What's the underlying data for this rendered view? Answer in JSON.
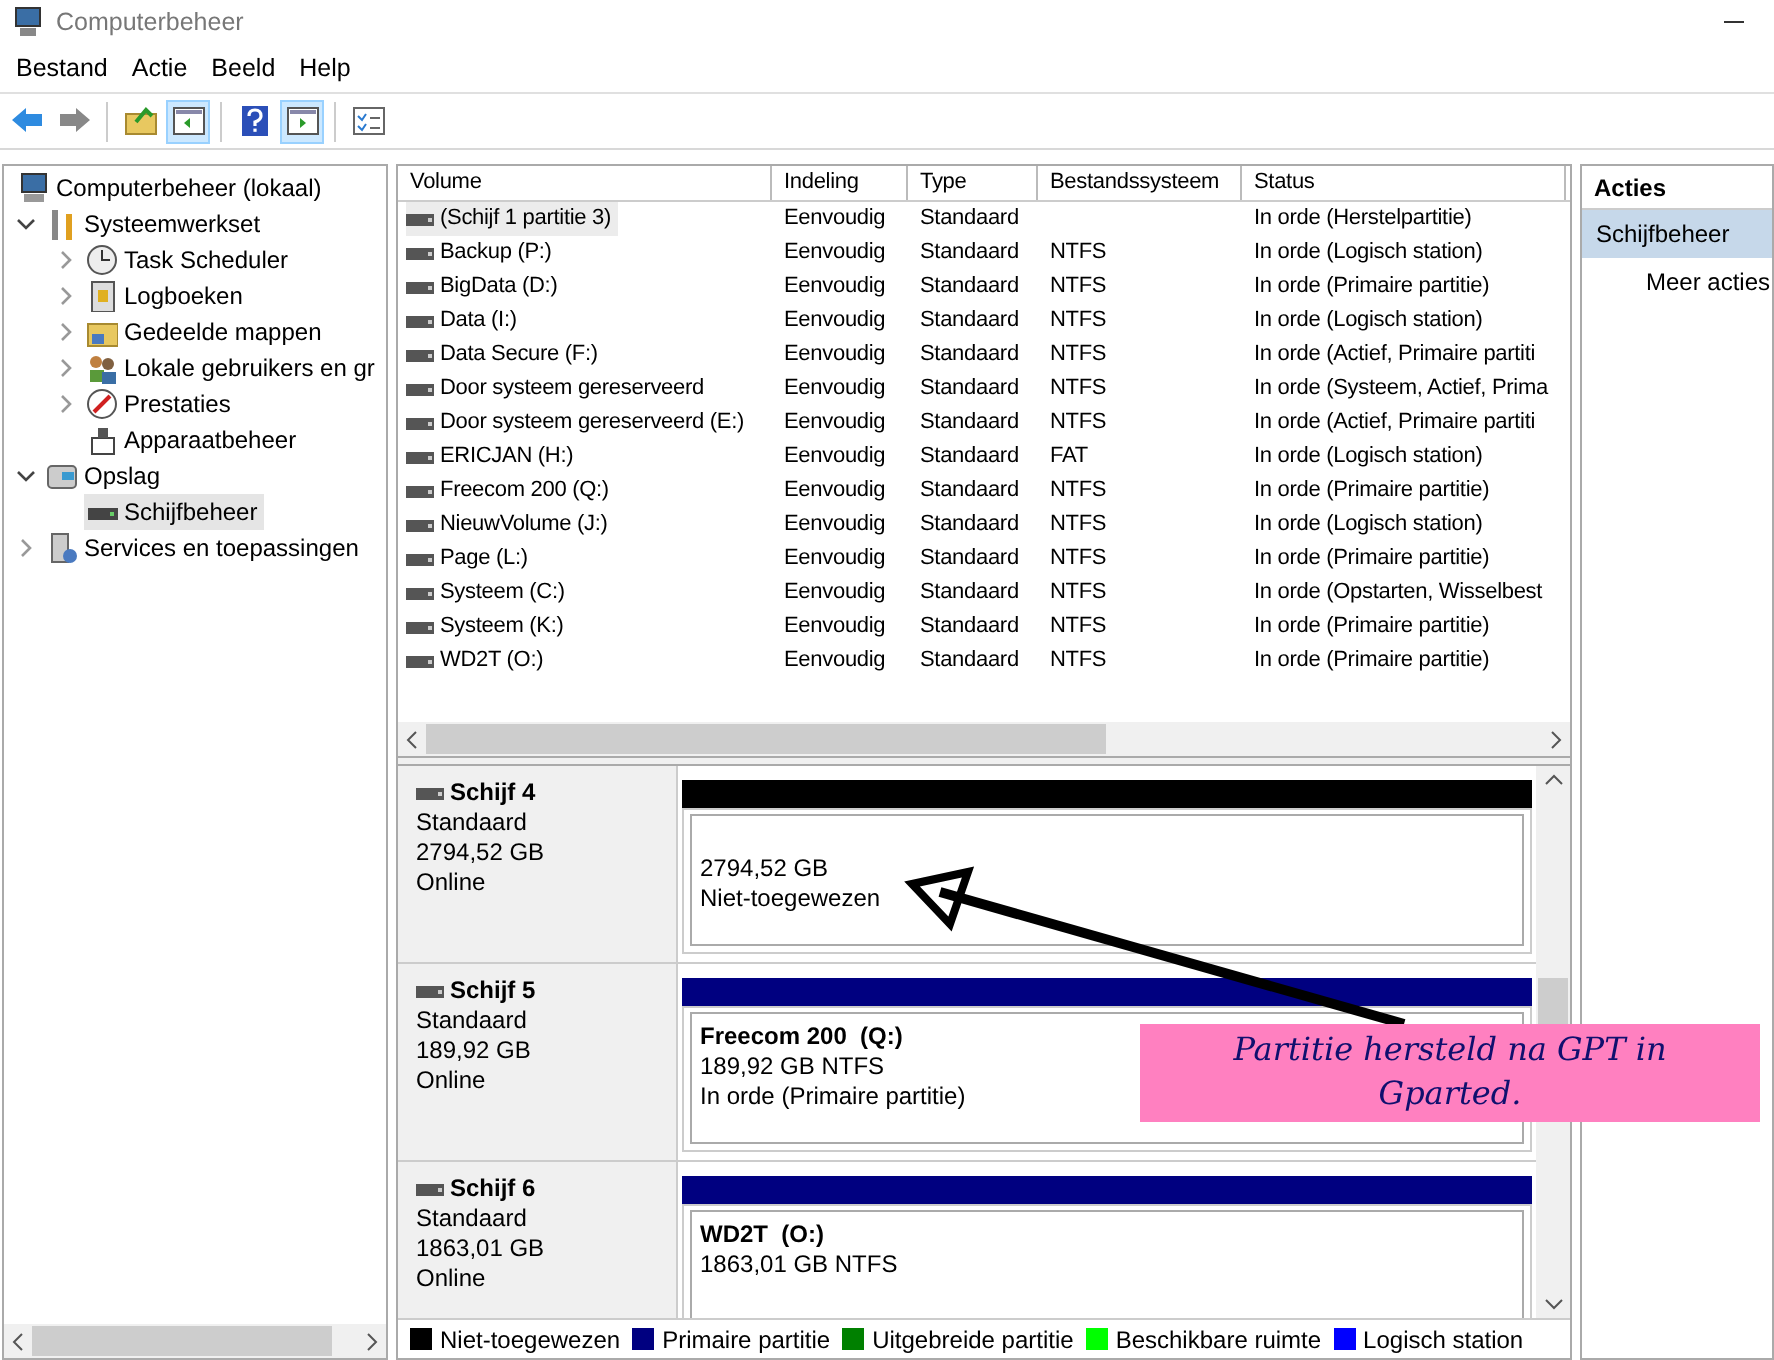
{
  "window": {
    "title": "Computerbeheer"
  },
  "menu": [
    "Bestand",
    "Actie",
    "Beeld",
    "Help"
  ],
  "toolbar": [
    {
      "kind": "back",
      "pressed": false
    },
    {
      "kind": "forward",
      "pressed": false
    },
    {
      "kind": "sep"
    },
    {
      "kind": "up",
      "pressed": false
    },
    {
      "kind": "tree",
      "pressed": true
    },
    {
      "kind": "sep"
    },
    {
      "kind": "help",
      "pressed": false
    },
    {
      "kind": "actionpane",
      "pressed": true
    },
    {
      "kind": "sep"
    },
    {
      "kind": "properties",
      "pressed": false
    }
  ],
  "tree": [
    {
      "label": "Computerbeheer (lokaal)",
      "kind": "computer",
      "selected": false,
      "children": [
        {
          "label": "Systeemwerkset",
          "kind": "tools",
          "expanded": true,
          "selected": false,
          "children": [
            {
              "label": "Task Scheduler",
              "kind": "clock",
              "expanded": false,
              "selected": false
            },
            {
              "label": "Logboeken",
              "kind": "log",
              "expanded": false,
              "selected": false
            },
            {
              "label": "Gedeelde mappen",
              "kind": "share",
              "expanded": false,
              "selected": false
            },
            {
              "label": "Lokale gebruikers en gr",
              "kind": "users",
              "expanded": false,
              "selected": false
            },
            {
              "label": "Prestaties",
              "kind": "gauge",
              "expanded": false,
              "selected": false
            },
            {
              "label": "Apparaatbeheer",
              "kind": "device",
              "selected": false
            }
          ]
        },
        {
          "label": "Opslag",
          "kind": "storage",
          "expanded": true,
          "selected": false,
          "children": [
            {
              "label": "Schijfbeheer",
              "kind": "disk",
              "selected": true
            }
          ]
        },
        {
          "label": "Services en toepassingen",
          "kind": "services",
          "expanded": false,
          "selected": false
        }
      ]
    }
  ],
  "table": {
    "columns": [
      "Volume",
      "Indeling",
      "Type",
      "Bestandssysteem",
      "Status"
    ],
    "rows": [
      {
        "selected": true,
        "cells": [
          "(Schijf 1 partitie 3)",
          "Eenvoudig",
          "Standaard",
          "",
          "In orde (Herstelpartitie)"
        ]
      },
      {
        "selected": false,
        "cells": [
          "Backup (P:)",
          "Eenvoudig",
          "Standaard",
          "NTFS",
          "In orde (Logisch station)"
        ]
      },
      {
        "selected": false,
        "cells": [
          "BigData (D:)",
          "Eenvoudig",
          "Standaard",
          "NTFS",
          "In orde (Primaire partitie)"
        ]
      },
      {
        "selected": false,
        "cells": [
          "Data (I:)",
          "Eenvoudig",
          "Standaard",
          "NTFS",
          "In orde (Logisch station)"
        ]
      },
      {
        "selected": false,
        "cells": [
          "Data Secure (F:)",
          "Eenvoudig",
          "Standaard",
          "NTFS",
          "In orde (Actief, Primaire partiti"
        ]
      },
      {
        "selected": false,
        "cells": [
          "Door systeem gereserveerd",
          "Eenvoudig",
          "Standaard",
          "NTFS",
          "In orde (Systeem, Actief, Prima"
        ]
      },
      {
        "selected": false,
        "cells": [
          "Door systeem gereserveerd (E:)",
          "Eenvoudig",
          "Standaard",
          "NTFS",
          "In orde (Actief, Primaire partiti"
        ]
      },
      {
        "selected": false,
        "cells": [
          "ERICJAN (H:)",
          "Eenvoudig",
          "Standaard",
          "FAT",
          "In orde (Logisch station)"
        ]
      },
      {
        "selected": false,
        "cells": [
          "Freecom 200 (Q:)",
          "Eenvoudig",
          "Standaard",
          "NTFS",
          "In orde (Primaire partitie)"
        ]
      },
      {
        "selected": false,
        "cells": [
          "NieuwVolume (J:)",
          "Eenvoudig",
          "Standaard",
          "NTFS",
          "In orde (Logisch station)"
        ]
      },
      {
        "selected": false,
        "cells": [
          "Page (L:)",
          "Eenvoudig",
          "Standaard",
          "NTFS",
          "In orde (Primaire partitie)"
        ]
      },
      {
        "selected": false,
        "cells": [
          "Systeem (C:)",
          "Eenvoudig",
          "Standaard",
          "NTFS",
          "In orde (Opstarten, Wisselbest"
        ]
      },
      {
        "selected": false,
        "cells": [
          "Systeem (K:)",
          "Eenvoudig",
          "Standaard",
          "NTFS",
          "In orde (Primaire partitie)"
        ]
      },
      {
        "selected": false,
        "cells": [
          "WD2T (O:)",
          "Eenvoudig",
          "Standaard",
          "NTFS",
          "In orde (Primaire partitie)"
        ]
      }
    ]
  },
  "disks": [
    {
      "name": "Schijf 4",
      "type": "Standaard",
      "size": "2794,52 GB",
      "status": "Online",
      "partitions": [
        {
          "color": "#000000",
          "lines": [
            "2794,52 GB",
            "Niet-toegewezen"
          ]
        }
      ]
    },
    {
      "name": "Schijf 5",
      "type": "Standaard",
      "size": "189,92 GB",
      "status": "Online",
      "partitions": [
        {
          "color": "#000080",
          "title": "Freecom 200  (Q:)",
          "lines": [
            "189,92 GB NTFS",
            "In orde (Primaire partitie)"
          ]
        }
      ]
    },
    {
      "name": "Schijf 6",
      "type": "Standaard",
      "size": "1863,01 GB",
      "status": "Online",
      "partitions": [
        {
          "color": "#000080",
          "title": "WD2T  (O:)",
          "lines": [
            "1863,01 GB NTFS"
          ]
        }
      ]
    }
  ],
  "legend": [
    {
      "label": "Niet-toegewezen",
      "color": "#000000"
    },
    {
      "label": "Primaire partitie",
      "color": "#000080"
    },
    {
      "label": "Uitgebreide partitie",
      "color": "#008000"
    },
    {
      "label": "Beschikbare ruimte",
      "color": "#00ff00"
    },
    {
      "label": "Logisch station",
      "color": "#0000ff"
    }
  ],
  "actions": {
    "title": "Acties",
    "items": [
      {
        "label": "Schijfbeheer",
        "kind": "header"
      },
      {
        "label": "Meer acties",
        "kind": "link"
      }
    ]
  },
  "annotation": {
    "text": "Partitie hersteld na GPT in Gparted."
  }
}
